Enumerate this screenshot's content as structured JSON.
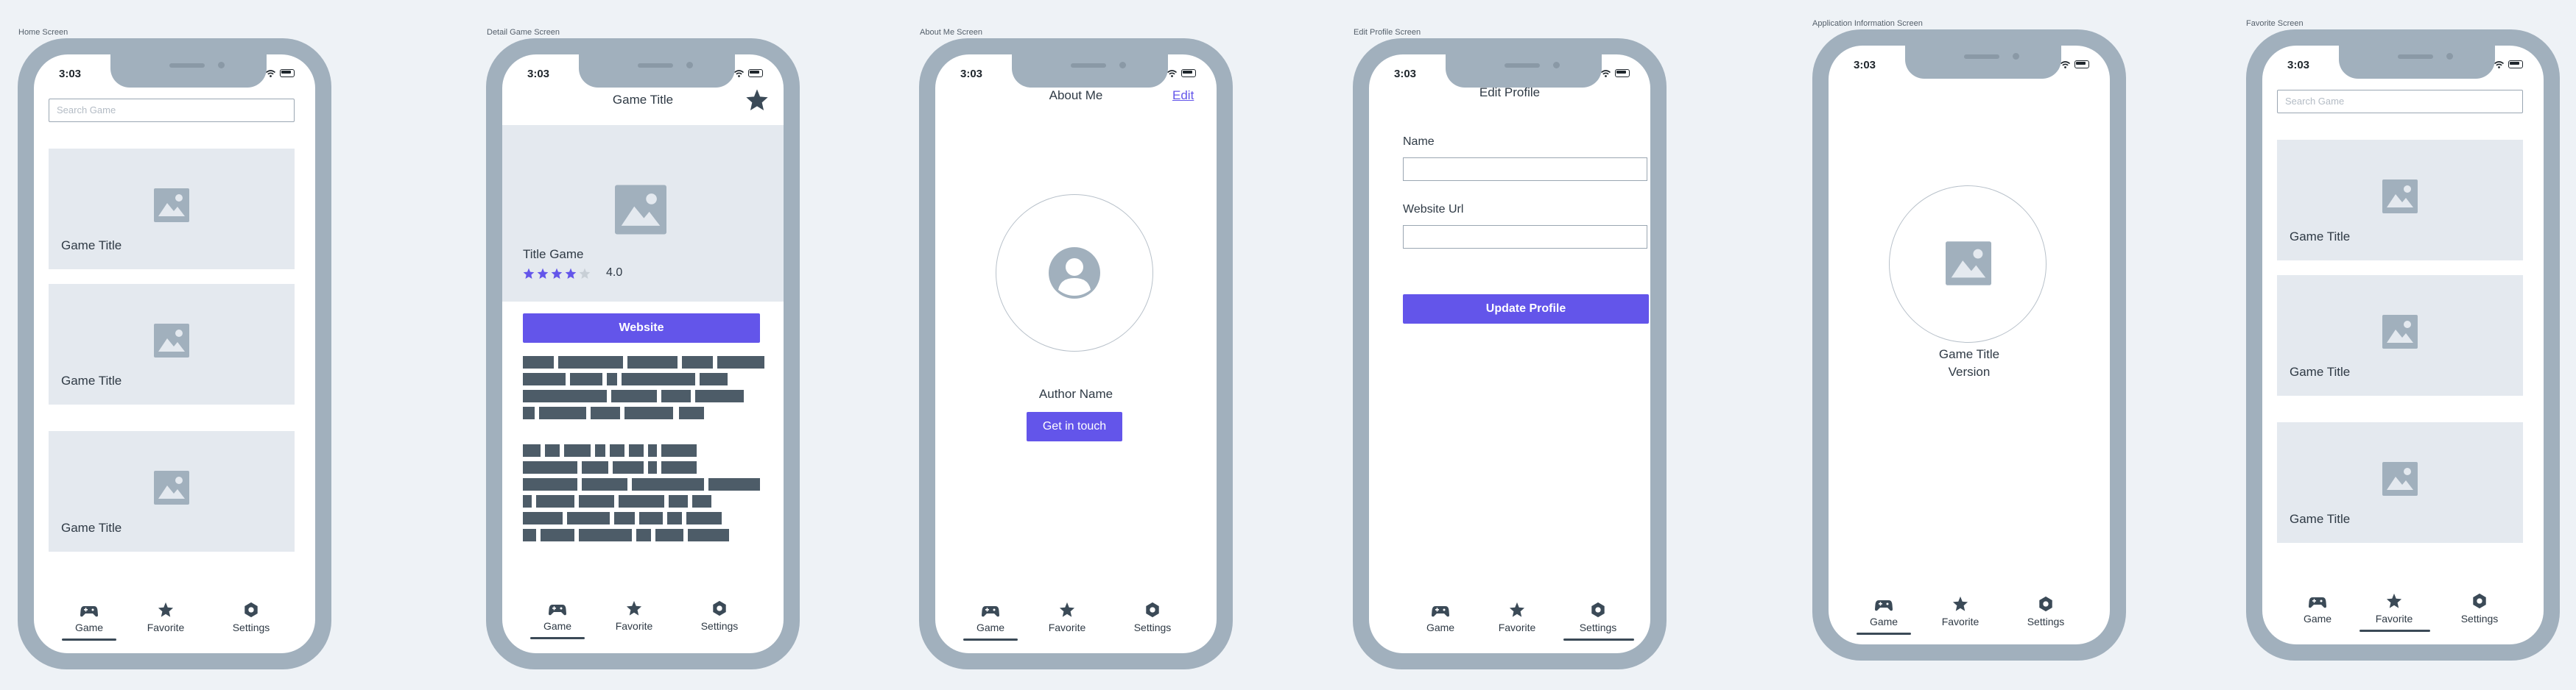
{
  "status_time": "3:03",
  "colors": {
    "accent": "#6355ea",
    "phone_frame": "#a1b0bd",
    "placeholder": "#e4e9ef",
    "icon_dark": "#3b4a57"
  },
  "tabs": {
    "game": "Game",
    "favorite": "Favorite",
    "settings": "Settings"
  },
  "screens": {
    "home": {
      "label": "Home Screen",
      "search_placeholder": "Search Game",
      "cards": [
        "Game Title",
        "Game Title",
        "Game Title"
      ],
      "active_tab": "game"
    },
    "detail": {
      "label": "Detail Game Screen",
      "title": "Game Title",
      "game_name": "Title Game",
      "rating": "4.0",
      "rating_value": 4,
      "rating_max": 5,
      "website_button": "Website",
      "active_tab": "game",
      "icons": {
        "favorite": "star-icon"
      }
    },
    "about": {
      "label": "About Me Screen",
      "title": "About Me",
      "edit": "Edit",
      "author": "Author Name",
      "contact_button": "Get in touch",
      "active_tab": "game",
      "icons": {
        "avatar": "user-icon"
      }
    },
    "edit_profile": {
      "label": "Edit Profile Screen",
      "title": "Edit Profile",
      "name_label": "Name",
      "website_label": "Website Url",
      "update_button": "Update Profile",
      "active_tab": "settings"
    },
    "app_info": {
      "label": "Application Information Screen",
      "game_title": "Game Title",
      "version": "Version",
      "active_tab": "game"
    },
    "favorite": {
      "label": "Favorite Screen",
      "search_placeholder": "Search Game",
      "cards": [
        "Game Title",
        "Game Title",
        "Game Title"
      ],
      "active_tab": "favorite"
    }
  }
}
